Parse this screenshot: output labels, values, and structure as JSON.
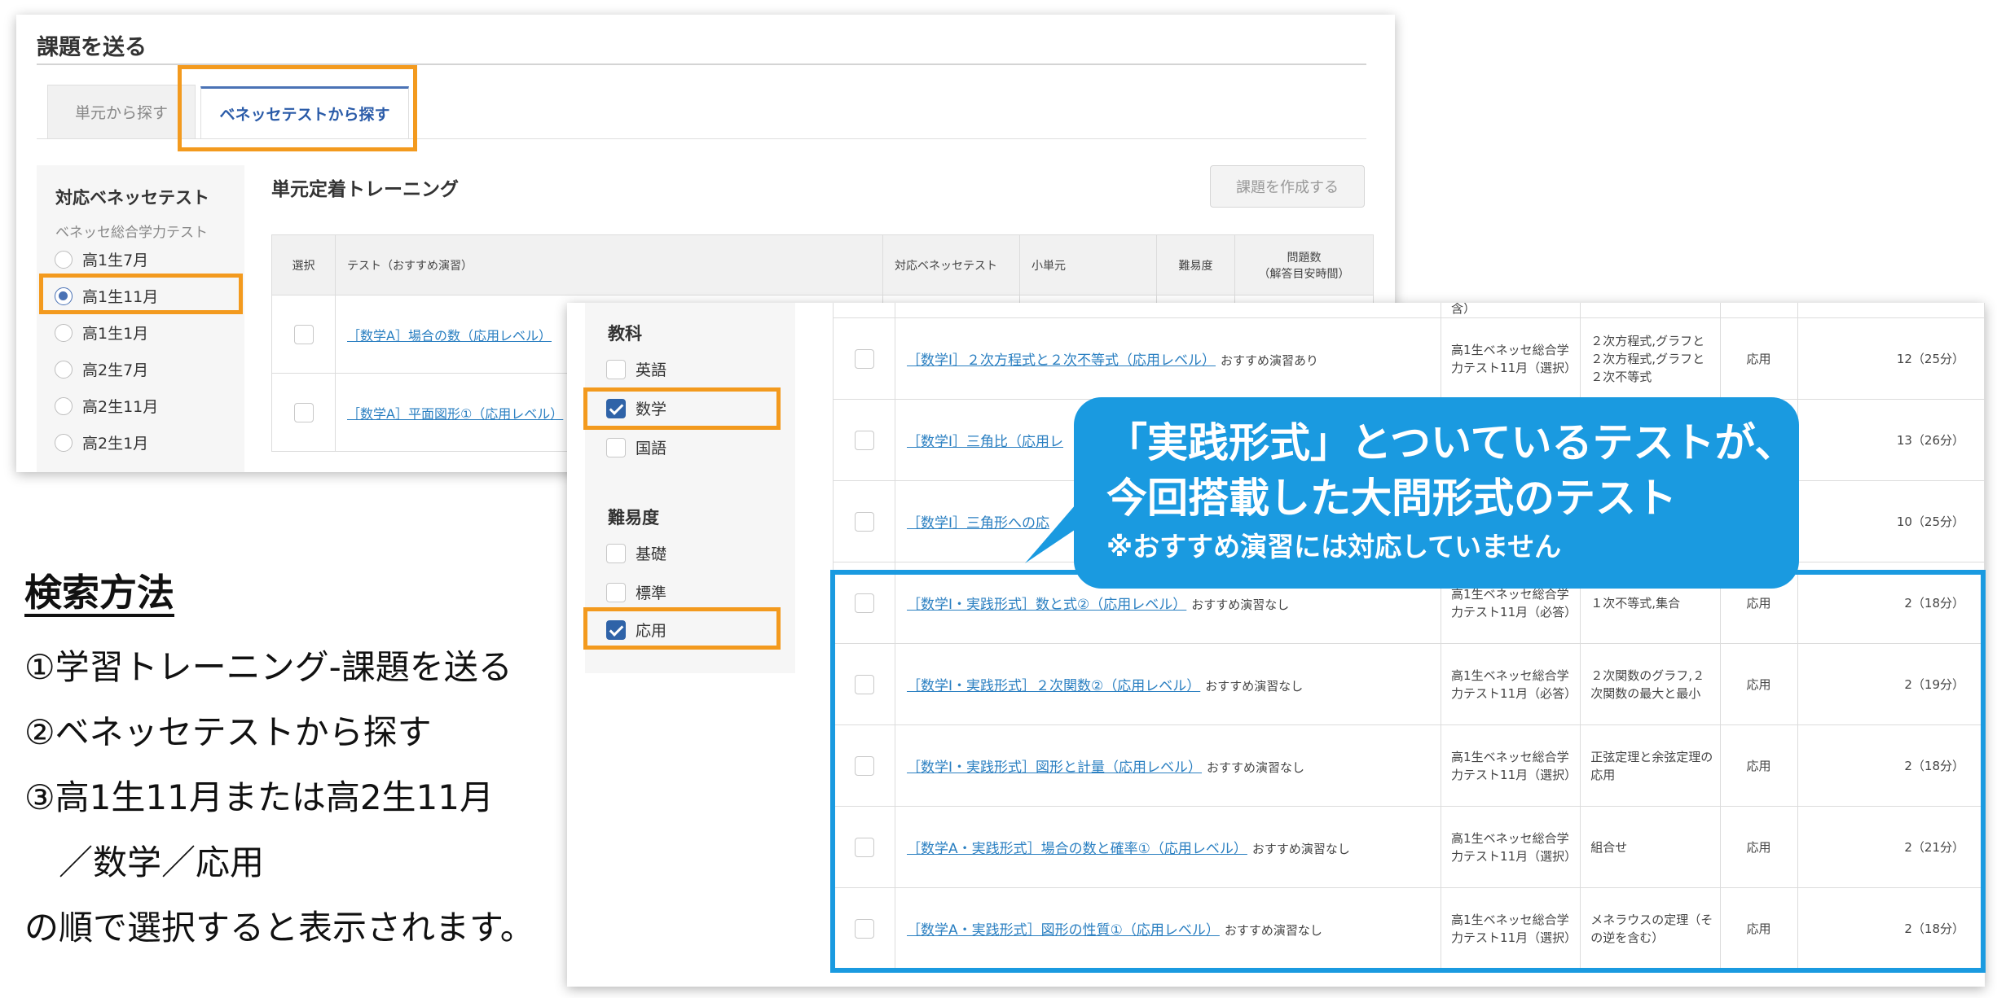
{
  "panel1": {
    "title": "課題を送る",
    "tabs": [
      {
        "label": "単元から探す",
        "active": false
      },
      {
        "label": "ベネッセテストから探す",
        "active": true
      }
    ],
    "sidebar": {
      "title": "対応ベネッセテスト",
      "subtitle": "ベネッセ総合学力テスト",
      "options": [
        {
          "label": "高1生7月",
          "selected": false
        },
        {
          "label": "高1生11月",
          "selected": true
        },
        {
          "label": "高1生1月",
          "selected": false
        },
        {
          "label": "高2生7月",
          "selected": false
        },
        {
          "label": "高2生11月",
          "selected": false
        },
        {
          "label": "高2生1月",
          "selected": false
        }
      ]
    },
    "heading": "単元定着トレーニング",
    "create_button": "課題を作成する",
    "columns": {
      "select": "選択",
      "test": "テスト（おすすめ演習）",
      "benesse": "対応ベネッセテスト",
      "subunit": "小単元",
      "difficulty": "難易度",
      "count_line1": "問題数",
      "count_line2": "（解答目安時間）"
    },
    "rows": [
      {
        "title": "［数学A］場合の数（応用レベル）"
      },
      {
        "title": "［数学A］平面図形①（応用レベル）"
      }
    ]
  },
  "panel2": {
    "subject": {
      "title": "教科",
      "options": [
        {
          "label": "英語",
          "checked": false
        },
        {
          "label": "数学",
          "checked": true
        },
        {
          "label": "国語",
          "checked": false
        }
      ]
    },
    "difficulty": {
      "title": "難易度",
      "options": [
        {
          "label": "基礎",
          "checked": false
        },
        {
          "label": "標準",
          "checked": false
        },
        {
          "label": "応用",
          "checked": true
        }
      ]
    },
    "partial_top": "含）",
    "rows": [
      {
        "title": "［数学Ⅰ］２次方程式と２次不等式（応用レベル）",
        "note": "おすすめ演習あり",
        "test": "高1生ベネッセ総合学力テスト11月（選択）",
        "subunit": "２次方程式,グラフと２次方程式,グラフと２次不等式",
        "level": "応用",
        "count": "12（25分）"
      },
      {
        "title": "［数学Ⅰ］三角比（応用レ",
        "note": "",
        "test": "",
        "subunit": "",
        "level": "",
        "count": "13（26分）"
      },
      {
        "title": "［数学Ⅰ］三角形への応",
        "note": "",
        "test": "",
        "subunit": "",
        "level": "",
        "count": "10（25分）"
      },
      {
        "title": "［数学Ⅰ・実践形式］数と式②（応用レベル）",
        "note": "おすすめ演習なし",
        "test": "高1生ベネッセ総合学力テスト11月（必答）",
        "subunit": "１次不等式,集合",
        "level": "応用",
        "count": "2（18分）"
      },
      {
        "title": "［数学Ⅰ・実践形式］２次関数②（応用レベル）",
        "note": "おすすめ演習なし",
        "test": "高1生ベネッセ総合学力テスト11月（必答）",
        "subunit": "２次関数のグラフ,２次関数の最大と最小",
        "level": "応用",
        "count": "2（19分）"
      },
      {
        "title": "［数学Ⅰ・実践形式］図形と計量（応用レベル）",
        "note": "おすすめ演習なし",
        "test": "高1生ベネッセ総合学力テスト11月（選択）",
        "subunit": "正弦定理と余弦定理の応用",
        "level": "応用",
        "count": "2（18分）"
      },
      {
        "title": "［数学A・実践形式］場合の数と確率①（応用レベル）",
        "note": "おすすめ演習なし",
        "test": "高1生ベネッセ総合学力テスト11月（選択）",
        "subunit": "組合せ",
        "level": "応用",
        "count": "2（21分）"
      },
      {
        "title": "［数学A・実践形式］図形の性質①（応用レベル）",
        "note": "おすすめ演習なし",
        "test": "高1生ベネッセ総合学力テスト11月（選択）",
        "subunit": "メネラウスの定理（その逆を含む）",
        "level": "応用",
        "count": "2（18分）"
      }
    ]
  },
  "callout": {
    "line1": "「実践形式」とついているテストが、",
    "line2": "今回搭載した大問形式のテスト",
    "line3": "※おすすめ演習には対応していません"
  },
  "instructions": {
    "title": "検索方法",
    "steps": [
      "①学習トレーニング-課題を送る",
      "②ベネッセテストから探す",
      "③高1生11月または高2生11月",
      "　／数学／応用",
      "の順で選択すると表示されます。"
    ]
  },
  "colors": {
    "highlight_orange": "#f39a1e",
    "callout_blue": "#1a9ae0",
    "link_blue": "#2a7fc1",
    "checkbox_blue": "#2f63a8"
  }
}
